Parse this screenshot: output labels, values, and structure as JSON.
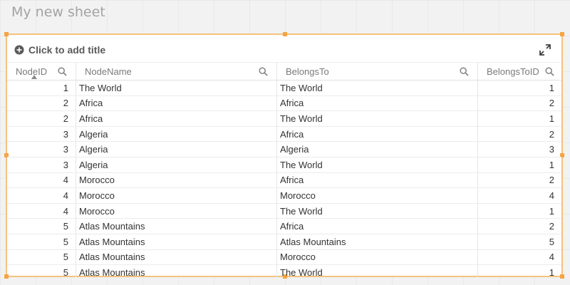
{
  "sheet": {
    "title": "My new sheet"
  },
  "panel": {
    "add_title_label": "Click to add title"
  },
  "table": {
    "columns": [
      "NodeID",
      "NodeName",
      "BelongsTo",
      "BelongsToID"
    ],
    "rows": [
      [
        "1",
        "The World",
        "The World",
        "1"
      ],
      [
        "2",
        "Africa",
        "Africa",
        "2"
      ],
      [
        "2",
        "Africa",
        "The World",
        "1"
      ],
      [
        "3",
        "Algeria",
        "Africa",
        "2"
      ],
      [
        "3",
        "Algeria",
        "Algeria",
        "3"
      ],
      [
        "3",
        "Algeria",
        "The World",
        "1"
      ],
      [
        "4",
        "Morocco",
        "Africa",
        "2"
      ],
      [
        "4",
        "Morocco",
        "Morocco",
        "4"
      ],
      [
        "4",
        "Morocco",
        "The World",
        "1"
      ],
      [
        "5",
        "Atlas Mountains",
        "Africa",
        "2"
      ],
      [
        "5",
        "Atlas Mountains",
        "Atlas Mountains",
        "5"
      ],
      [
        "5",
        "Atlas Mountains",
        "Morocco",
        "4"
      ],
      [
        "5",
        "Atlas Mountains",
        "The World",
        "1"
      ]
    ]
  },
  "colors": {
    "selection_border": "#f5c27e",
    "handle": "#f5a445"
  },
  "icons": {
    "add": "plus-circle-icon",
    "expand": "expand-icon",
    "search": "search-icon",
    "sort": "sort-ascending-icon"
  }
}
